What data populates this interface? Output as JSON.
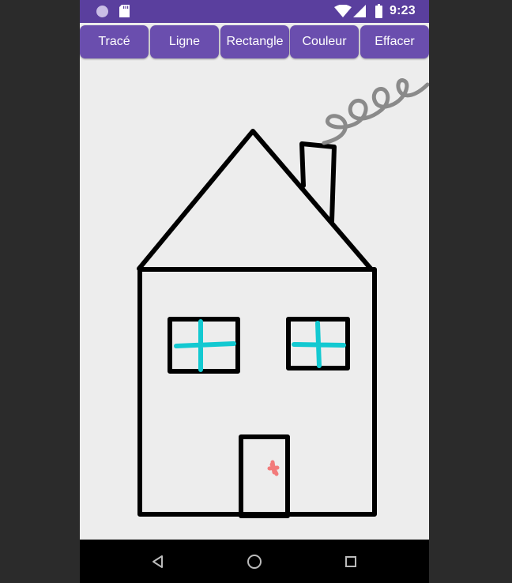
{
  "status_bar": {
    "time": "9:23",
    "icons": [
      "notification-dot-icon",
      "sd-card-icon",
      "wifi-icon",
      "cell-signal-icon",
      "battery-icon"
    ]
  },
  "toolbar": {
    "buttons": [
      {
        "label": "Tracé"
      },
      {
        "label": "Ligne"
      },
      {
        "label": "Rectangle"
      },
      {
        "label": "Couleur"
      },
      {
        "label": "Effacer"
      }
    ]
  },
  "drawing": {
    "colors": {
      "outline": "#000000",
      "window_cross": "#13c9d1",
      "smoke": "#8a8a8a",
      "door_knob": "#f27a7a"
    }
  },
  "nav_bar": {
    "icons": [
      "back-icon",
      "home-icon",
      "recents-icon"
    ]
  },
  "theme": {
    "primary": "#6a4eae",
    "status_bar": "#5a3f9e"
  }
}
